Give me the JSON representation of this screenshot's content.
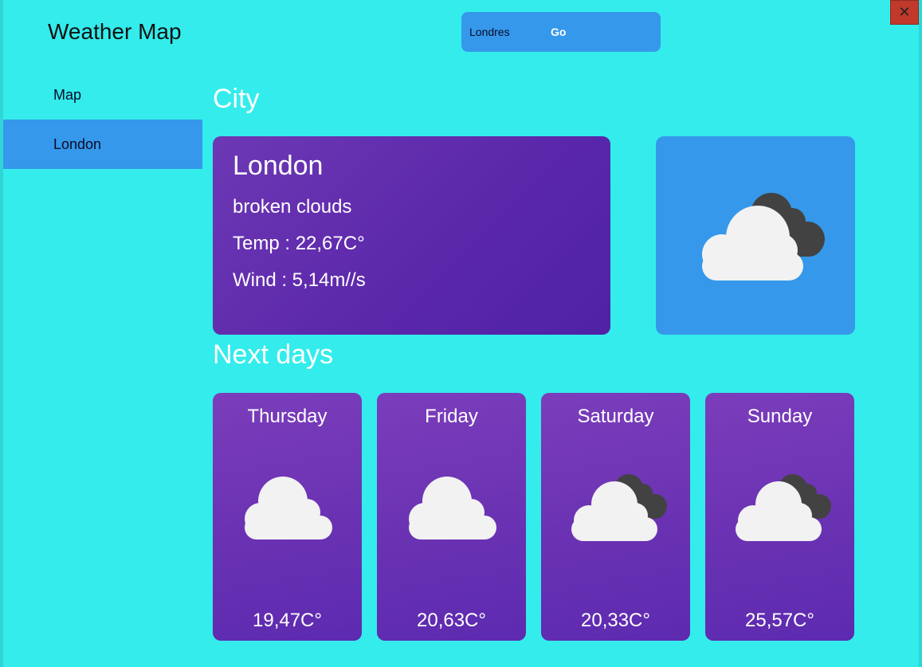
{
  "app": {
    "title": "Weather Map",
    "close_glyph": "✕"
  },
  "search": {
    "value": "Londres",
    "go_label": "Go"
  },
  "nav": {
    "items": [
      {
        "label": "Map"
      },
      {
        "label": "London"
      }
    ],
    "active_index": 1
  },
  "sections": {
    "city_title": "City",
    "next_days_title": "Next days"
  },
  "city": {
    "name": "London",
    "description": "broken clouds",
    "temp": "Temp : 22,67C°",
    "wind": "Wind : 5,14m//s",
    "icon": "broken-clouds-icon"
  },
  "days": [
    {
      "name": "Thursday",
      "temp": "19,47C°",
      "icon": "cloud-icon"
    },
    {
      "name": "Friday",
      "temp": "20,63C°",
      "icon": "cloud-icon"
    },
    {
      "name": "Saturday",
      "temp": "20,33C°",
      "icon": "broken-clouds-icon"
    },
    {
      "name": "Sunday",
      "temp": "25,57C°",
      "icon": "broken-clouds-icon"
    }
  ],
  "colors": {
    "background": "#34ecec",
    "accent_blue": "#3598ea",
    "card_purple": "#5f2bb0",
    "close_red": "#c0392b"
  }
}
